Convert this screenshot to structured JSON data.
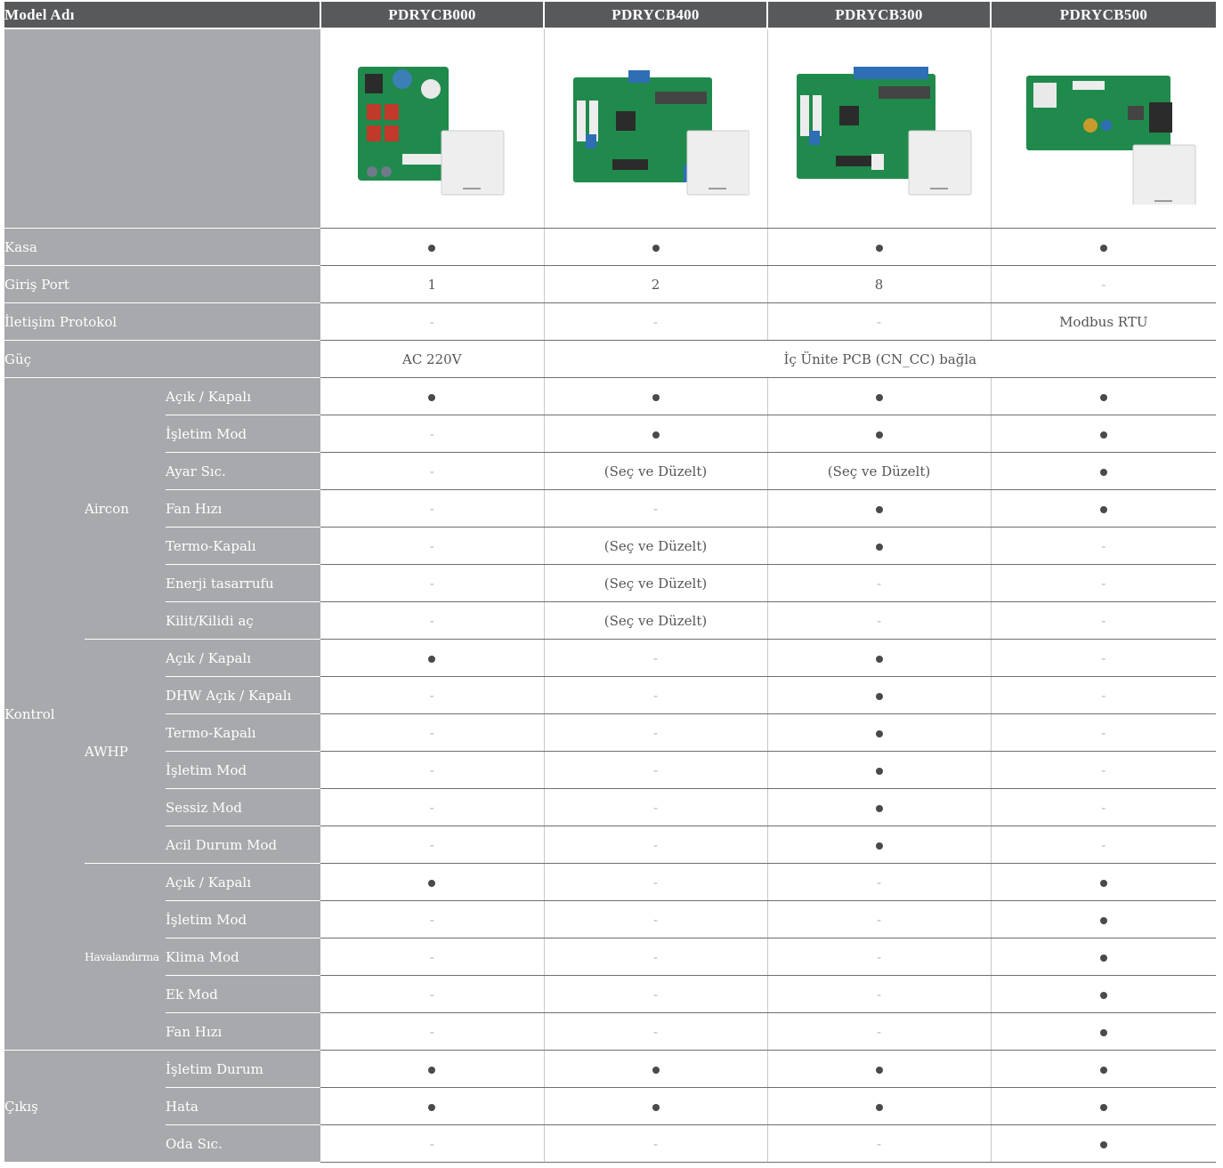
{
  "header": {
    "label": "Model Adı",
    "models": [
      "PDRYCB000",
      "PDRYCB400",
      "PDRYCB300",
      "PDRYCB500"
    ]
  },
  "product_images": [
    "pcb-board-with-controller-box",
    "pcb-board-with-controller-box",
    "pcb-board-with-controller-box",
    "pcb-board-with-controller-box"
  ],
  "rows": {
    "kasa": {
      "label": "Kasa",
      "values": [
        "●",
        "●",
        "●",
        "●"
      ]
    },
    "giris_port": {
      "label": "Giriş Port",
      "values": [
        "1",
        "2",
        "8",
        "-"
      ]
    },
    "iletisim": {
      "label": "İletişim Protokol",
      "values": [
        "-",
        "-",
        "-",
        "Modbus RTU"
      ]
    },
    "guc": {
      "label": "Güç",
      "values": [
        "AC 220V",
        "İç Ünite PCB (CN_CC) bağla"
      ]
    }
  },
  "kontrol": {
    "label": "Kontrol",
    "aircon": {
      "label": "Aircon",
      "rows": [
        {
          "label": "Açık / Kapalı",
          "values": [
            "●",
            "●",
            "●",
            "●"
          ]
        },
        {
          "label": "İşletim Mod",
          "values": [
            "-",
            "●",
            "●",
            "●"
          ]
        },
        {
          "label": "Ayar Sıc.",
          "values": [
            "-",
            "(Seç ve Düzelt)",
            "(Seç ve Düzelt)",
            "●"
          ]
        },
        {
          "label": "Fan Hızı",
          "values": [
            "-",
            "-",
            "●",
            "●"
          ]
        },
        {
          "label": "Termo-Kapalı",
          "values": [
            "-",
            "(Seç ve Düzelt)",
            "●",
            "-"
          ]
        },
        {
          "label": "Enerji tasarrufu",
          "values": [
            "-",
            "(Seç ve Düzelt)",
            "-",
            "-"
          ]
        },
        {
          "label": "Kilit/Kilidi aç",
          "values": [
            "-",
            "(Seç ve Düzelt)",
            "-",
            "-"
          ]
        }
      ]
    },
    "awhp": {
      "label": "AWHP",
      "rows": [
        {
          "label": "Açık / Kapalı",
          "values": [
            "●",
            "-",
            "●",
            "-"
          ]
        },
        {
          "label": "DHW Açık / Kapalı",
          "values": [
            "-",
            "-",
            "●",
            "-"
          ]
        },
        {
          "label": "Termo-Kapalı",
          "values": [
            "-",
            "-",
            "●",
            "-"
          ]
        },
        {
          "label": "İşletim Mod",
          "values": [
            "-",
            "-",
            "●",
            "-"
          ]
        },
        {
          "label": "Sessiz Mod",
          "values": [
            "-",
            "-",
            "●",
            "-"
          ]
        },
        {
          "label": "Acil Durum Mod",
          "values": [
            "-",
            "-",
            "●",
            "-"
          ]
        }
      ]
    },
    "havalandirma": {
      "label": "Havalandırma",
      "rows": [
        {
          "label": "Açık / Kapalı",
          "values": [
            "●",
            "-",
            "-",
            "●"
          ]
        },
        {
          "label": "İşletim Mod",
          "values": [
            "-",
            "-",
            "-",
            "●"
          ]
        },
        {
          "label": "Klima Mod",
          "values": [
            "-",
            "-",
            "-",
            "●"
          ]
        },
        {
          "label": "Ek Mod",
          "values": [
            "-",
            "-",
            "-",
            "●"
          ]
        },
        {
          "label": "Fan Hızı",
          "values": [
            "-",
            "-",
            "-",
            "●"
          ]
        }
      ]
    }
  },
  "cikis": {
    "label": "Çıkış",
    "rows": [
      {
        "label": "İşletim Durum",
        "values": [
          "●",
          "●",
          "●",
          "●"
        ]
      },
      {
        "label": "Hata",
        "values": [
          "●",
          "●",
          "●",
          "●"
        ]
      },
      {
        "label": "Oda Sıc.",
        "values": [
          "-",
          "-",
          "-",
          "●"
        ]
      }
    ]
  },
  "colors": {
    "header_bg": "#58595b",
    "label_bg": "#a7a9ac",
    "pcb_green": "#1f8a4c",
    "connector_blue": "#2f6db5"
  }
}
